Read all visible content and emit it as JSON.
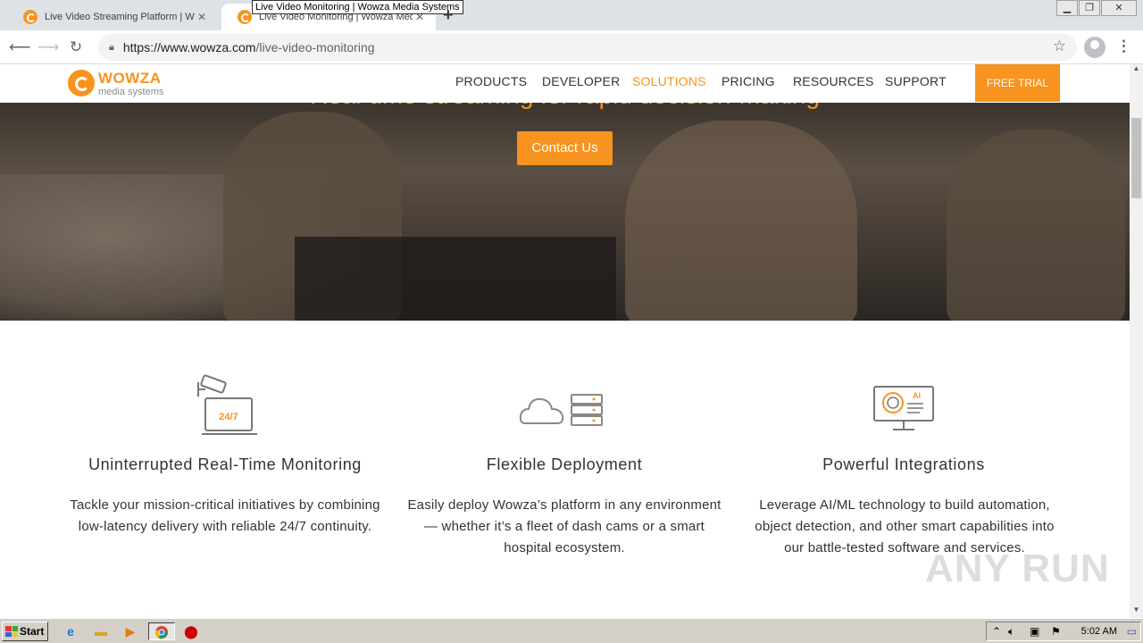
{
  "browser": {
    "tabs": [
      {
        "title": "Live Video Streaming Platform | Wowza Media Systems",
        "active": false
      },
      {
        "title": "Live Video Monitoring | Wowza Media Systems",
        "active": true
      }
    ],
    "tooltip": "Live Video Monitoring | Wowza Media Systems",
    "new_tab_glyph": "+",
    "url_host": "https://www.wowza.com",
    "url_path": "/live-video-monitoring"
  },
  "site": {
    "logo_word": "WOWZA",
    "logo_sub": "media systems",
    "nav": [
      "PRODUCTS",
      "DEVELOPER",
      "SOLUTIONS",
      "PRICING",
      "RESOURCES",
      "SUPPORT"
    ],
    "active_nav": "SOLUTIONS",
    "free_trial": "FREE TRIAL",
    "accent_color": "#f7931e"
  },
  "hero": {
    "headline": "Real-time streaming for rapid decision-making",
    "cta": "Contact Us"
  },
  "features": [
    {
      "icon": "camera-laptop-24-7-icon",
      "title": "Uninterrupted Real-Time Monitoring",
      "description": "Tackle your mission-critical initiatives by combining low-latency delivery with reliable 24/7 continuity.",
      "badge": "24/7"
    },
    {
      "icon": "cloud-server-icon",
      "title": "Flexible Deployment",
      "description": "Easily deploy Wowza’s platform in any environment — whether it’s a fleet of dash cams or a smart hospital ecosystem."
    },
    {
      "icon": "ai-monitor-icon",
      "title": "Powerful Integrations",
      "description": "Leverage AI/ML technology to build automation, object detection, and other smart capabilities into our battle-tested software and services.",
      "badge": "AI"
    }
  ],
  "watermark": "ANY RUN",
  "taskbar": {
    "start_label": "Start",
    "clock": "5:02 AM"
  }
}
